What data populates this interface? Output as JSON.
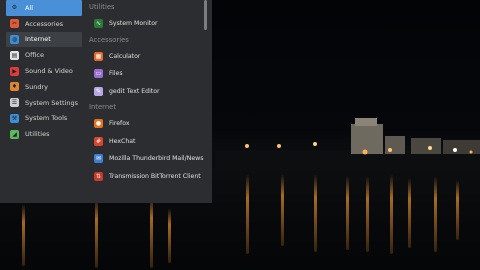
{
  "menu": {
    "categories": [
      {
        "label": "All",
        "icon": "gear-icon",
        "color": "#4a90d9",
        "state": "active"
      },
      {
        "label": "Accessories",
        "icon": "accessories-icon",
        "color": "#e05a3a",
        "state": "normal"
      },
      {
        "label": "Internet",
        "icon": "globe-icon",
        "color": "#3a8fd6",
        "state": "hover"
      },
      {
        "label": "Office",
        "icon": "office-icon",
        "color": "#e6e6e6",
        "state": "normal"
      },
      {
        "label": "Sound & Video",
        "icon": "media-icon",
        "color": "#e33a3a",
        "state": "normal"
      },
      {
        "label": "Sundry",
        "icon": "sundry-icon",
        "color": "#e0862e",
        "state": "normal"
      },
      {
        "label": "System Settings",
        "icon": "settings-icon",
        "color": "#cfcfcf",
        "state": "normal"
      },
      {
        "label": "System Tools",
        "icon": "tools-icon",
        "color": "#3a8fd6",
        "state": "normal"
      },
      {
        "label": "Utilities",
        "icon": "utilities-icon",
        "color": "#5cb85c",
        "state": "normal"
      }
    ],
    "sections": [
      {
        "title": "Utilities",
        "apps": [
          {
            "label": "System Monitor",
            "icon": "monitor-icon",
            "color": "#2b7a3a"
          }
        ]
      },
      {
        "title": "Accessories",
        "apps": [
          {
            "label": "Calculator",
            "icon": "calculator-icon",
            "color": "#e46a2a"
          },
          {
            "label": "Files",
            "icon": "folder-icon",
            "color": "#9a6fd0"
          },
          {
            "label": "gedit Text Editor",
            "icon": "text-editor-icon",
            "color": "#b9a8e6"
          }
        ]
      },
      {
        "title": "Internet",
        "apps": [
          {
            "label": "Firefox",
            "icon": "firefox-icon",
            "color": "#e8711d"
          },
          {
            "label": "HexChat",
            "icon": "hexchat-icon",
            "color": "#d9452e"
          },
          {
            "label": "Mozilla Thunderbird Mail/News",
            "icon": "thunderbird-icon",
            "color": "#3d7fd1"
          },
          {
            "label": "Transmission BitTorrent Client",
            "icon": "transmission-icon",
            "color": "#c83a2a"
          }
        ]
      }
    ]
  }
}
